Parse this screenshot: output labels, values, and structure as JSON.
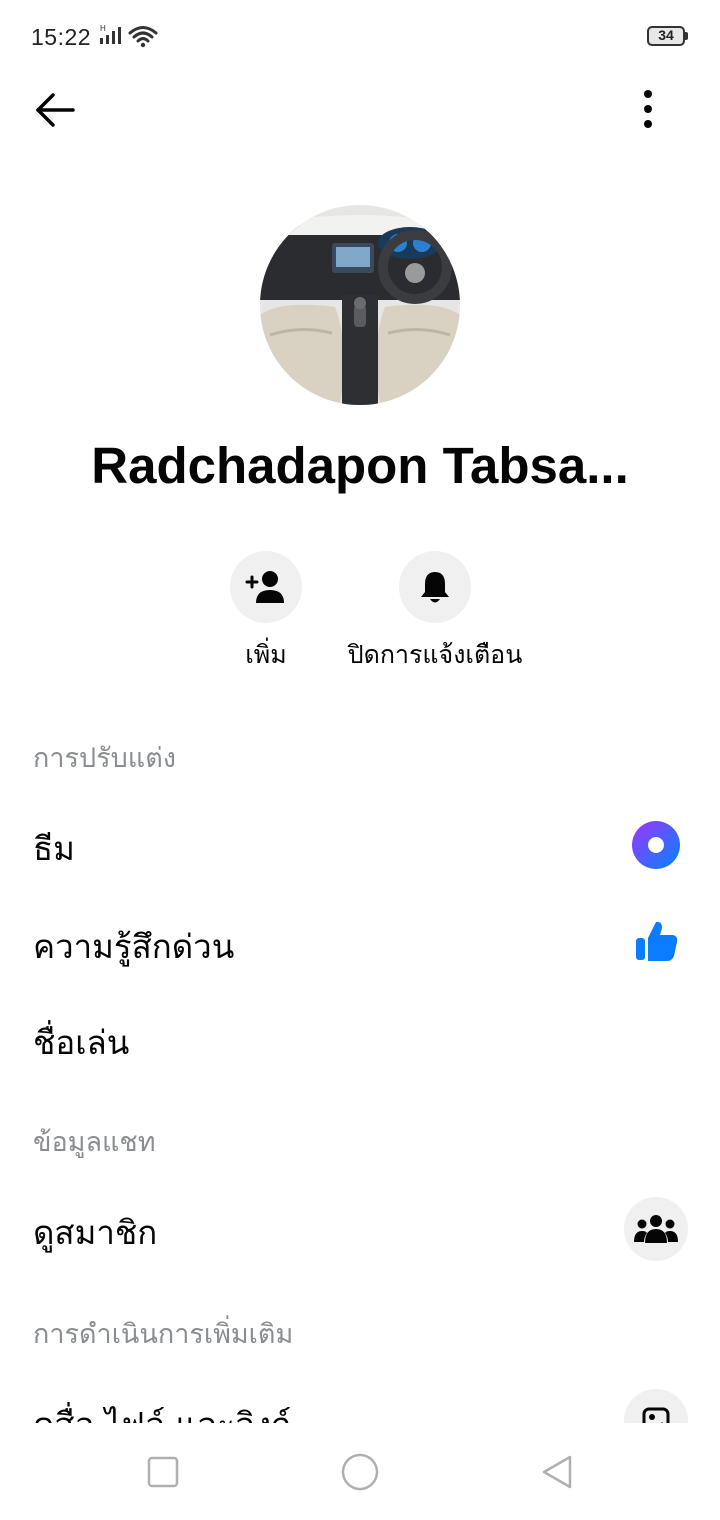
{
  "status_bar": {
    "time": "15:22",
    "battery": "34"
  },
  "contact": {
    "name": "Radchadapon Tabsa..."
  },
  "actions": [
    {
      "label": "เพิ่ม",
      "icon": "add-person-icon"
    },
    {
      "label": "ปิดการแจ้งเตือน",
      "icon": "bell-icon"
    }
  ],
  "sections": {
    "customize": {
      "title": "การปรับแต่ง",
      "items": [
        {
          "label": "ธีม",
          "icon": "theme-circle-icon"
        },
        {
          "label": "ความรู้สึกด่วน",
          "icon": "thumbs-up-icon"
        },
        {
          "label": "ชื่อเล่น"
        }
      ]
    },
    "chat_info": {
      "title": "ข้อมูลแชท",
      "items": [
        {
          "label": "ดูสมาชิก",
          "icon": "group-icon"
        }
      ]
    },
    "more_actions": {
      "title": "การดำเนินการเพิ่มเติม",
      "items": [
        {
          "label": "ดูสื่อ ไฟล์ และลิงก์",
          "icon": "media-icon"
        }
      ]
    }
  },
  "colors": {
    "accent_blue": "#0a7cff",
    "theme_gradient_start": "#a033ff",
    "theme_gradient_end": "#0084ff",
    "section_grey": "#8a8d91"
  }
}
